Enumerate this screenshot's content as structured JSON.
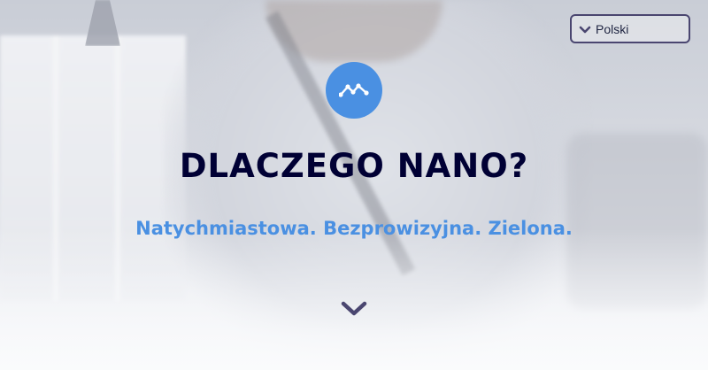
{
  "language_selector": {
    "selected": "Polski",
    "icon": "chevron-down-icon"
  },
  "hero": {
    "logo_icon": "nano-logo-icon",
    "title": "DLACZEGO NANO?",
    "subtitle": "Natychmiastowa. Bezprowizyjna. Zielona.",
    "scroll_icon": "chevron-down-icon"
  },
  "colors": {
    "accent": "#4a90e2",
    "title": "#000034",
    "chevron": "#4a4670"
  }
}
